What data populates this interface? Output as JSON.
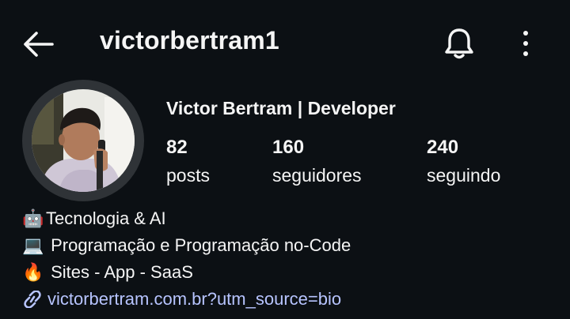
{
  "header": {
    "username": "victorbertram1",
    "back_icon": "arrow-left-icon",
    "notification_icon": "bell-icon",
    "menu_icon": "more-vertical-icon"
  },
  "profile": {
    "display_name": "Victor Bertram | Developer",
    "stats": [
      {
        "value": "82",
        "label": "posts"
      },
      {
        "value": "160",
        "label": "seguidores"
      },
      {
        "value": "240",
        "label": "seguindo"
      }
    ]
  },
  "bio": {
    "lines": [
      {
        "emoji": "🤖",
        "text": "Tecnologia & AI"
      },
      {
        "emoji": "💻",
        "text": " Programação e Programação no-Code"
      },
      {
        "emoji": "🔥",
        "text": " Sites - App - SaaS"
      }
    ],
    "link": "victorbertram.com.br?utm_source=bio"
  },
  "colors": {
    "background": "#0c1014",
    "text": "#f5f5f5",
    "link": "#b7c4ff",
    "avatar_ring": "#2f3337"
  }
}
